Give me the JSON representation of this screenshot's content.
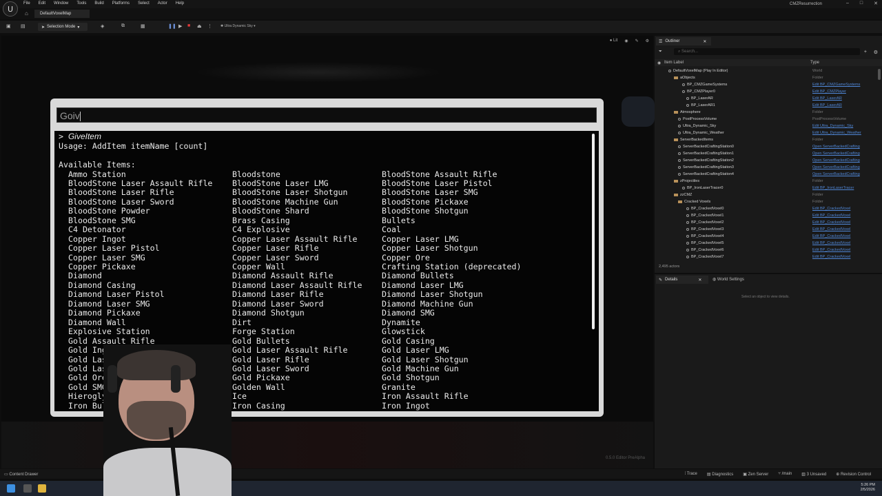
{
  "app": {
    "menu": [
      "File",
      "Edit",
      "Window",
      "Tools",
      "Build",
      "Platforms",
      "Select",
      "Actor",
      "Help"
    ],
    "project_name": "CMZResurrection",
    "window_controls": [
      "–",
      "□",
      "✕"
    ],
    "map_tab": "DefaultVoxelMap"
  },
  "toolbar": {
    "mode_label": "Selection Mode",
    "sky_label": "Ultra Dynamic Sky"
  },
  "viewport": {
    "view_mode": "Lit",
    "version_text": "0.5.0 Editor PreAlpha"
  },
  "console": {
    "input_value": "Goiv",
    "output": {
      "command_prefix": ">",
      "command": "GiveItem",
      "usage": "Usage: AddItem itemName [count]",
      "available_header": "Available Items:",
      "rows": [
        [
          "Ammo Station",
          "Bloodstone",
          "BloodStone Assault Rifle"
        ],
        [
          "BloodStone Laser Assault Rifle",
          "BloodStone Laser LMG",
          "BloodStone Laser Pistol"
        ],
        [
          "BloodStone Laser Rifle",
          "BloodStone Laser Shotgun",
          "BloodStone Laser SMG"
        ],
        [
          "BloodStone Laser Sword",
          "BloodStone Machine Gun",
          "BloodStone Pickaxe"
        ],
        [
          "BloodStone Powder",
          "BloodStone Shard",
          "BloodStone Shotgun"
        ],
        [
          "BloodStone SMG",
          "Brass Casing",
          "Bullets"
        ],
        [
          "C4 Detonator",
          "C4 Explosive",
          "Coal"
        ],
        [
          "Copper Ingot",
          "Copper Laser Assault Rifle",
          "Copper Laser LMG"
        ],
        [
          "Copper Laser Pistol",
          "Copper Laser Rifle",
          "Copper Laser Shotgun"
        ],
        [
          "Copper Laser SMG",
          "Copper Laser Sword",
          "Copper Ore"
        ],
        [
          "Copper Pickaxe",
          "Copper Wall",
          "Crafting Station (deprecated)"
        ],
        [
          "Diamond",
          "Diamond Assault Rifle",
          "Diamond Bullets"
        ],
        [
          "Diamond Casing",
          "Diamond Laser Assault Rifle",
          "Diamond Laser LMG"
        ],
        [
          "Diamond Laser Pistol",
          "Diamond Laser Rifle",
          "Diamond Laser Shotgun"
        ],
        [
          "Diamond Laser SMG",
          "Diamond Laser Sword",
          "Diamond Machine Gun"
        ],
        [
          "Diamond Pickaxe",
          "Diamond Shotgun",
          "Diamond SMG"
        ],
        [
          "Diamond Wall",
          "Dirt",
          "Dynamite"
        ],
        [
          "Explosive Station",
          "Forge Station",
          "Glowstick"
        ],
        [
          "Gold Assault Rifle",
          "Gold Bullets",
          "Gold Casing"
        ],
        [
          "Gold Ingot",
          "Gold Laser Assault Rifle",
          "Gold Laser LMG"
        ],
        [
          "Gold Laser",
          "Gold Laser Rifle",
          "Gold Laser Shotgun"
        ],
        [
          "Gold Laser",
          "Gold Laser Sword",
          "Gold Machine Gun"
        ],
        [
          "Gold Ore",
          "Gold Pickaxe",
          "Gold Shotgun"
        ],
        [
          "Gold SMG",
          "Golden Wall",
          "Granite"
        ],
        [
          "Hieroglyp",
          "Ice",
          "Iron Assault Rifle"
        ],
        [
          "Iron Bulle",
          "Iron Casing",
          "Iron Ingot"
        ]
      ]
    }
  },
  "outliner": {
    "tab_label": "Outliner",
    "search_placeholder": "Search...",
    "col_label": "Item Label",
    "col_type": "Type",
    "actor_count": "2,495 actors",
    "rows": [
      {
        "label": "DefaultVoxelMap (Play In Editor)",
        "type": "World",
        "kind": "world",
        "link": false
      },
      {
        "label": "aObjects",
        "type": "Folder",
        "kind": "folder",
        "link": false
      },
      {
        "label": "BP_CMZGameSystems",
        "type": "Edit BP_CMZGameSystems",
        "kind": "actor",
        "link": true
      },
      {
        "label": "BP_CMZPlayer0",
        "type": "Edit BP_CMZPlayer",
        "kind": "actor",
        "link": true
      },
      {
        "label": "BP_LaserAR",
        "type": "Edit BP_LaserAR",
        "kind": "actor",
        "link": true
      },
      {
        "label": "BP_LaserAR1",
        "type": "Edit BP_LaserAR",
        "kind": "actor",
        "link": true
      },
      {
        "label": "Atmosphere",
        "type": "Folder",
        "kind": "folder",
        "link": false
      },
      {
        "label": "PostProcessVolume",
        "type": "PostProcessVolume",
        "kind": "actor",
        "link": false
      },
      {
        "label": "Ultra_Dynamic_Sky",
        "type": "Edit Ultra_Dynamic_Sky",
        "kind": "actor",
        "link": true
      },
      {
        "label": "Ultra_Dynamic_Weather",
        "type": "Edit Ultra_Dynamic_Weather",
        "kind": "actor",
        "link": true
      },
      {
        "label": "ServerBackedItems",
        "type": "Folder",
        "kind": "folder",
        "link": false
      },
      {
        "label": "ServerBackedCraftingStation0",
        "type": "Open ServerBackedCrafting",
        "kind": "actor",
        "link": true
      },
      {
        "label": "ServerBackedCraftingStation1",
        "type": "Open ServerBackedCrafting",
        "kind": "actor",
        "link": true
      },
      {
        "label": "ServerBackedCraftingStation2",
        "type": "Open ServerBackedCrafting",
        "kind": "actor",
        "link": true
      },
      {
        "label": "ServerBackedCraftingStation3",
        "type": "Open ServerBackedCrafting",
        "kind": "actor",
        "link": true
      },
      {
        "label": "ServerBackedCraftingStation4",
        "type": "Open ServerBackedCrafting",
        "kind": "actor",
        "link": true
      },
      {
        "label": "zProjectiles",
        "type": "Folder",
        "kind": "folder",
        "link": false
      },
      {
        "label": "BP_IronLaserTracer0",
        "type": "Edit BP_IronLaserTracer",
        "kind": "actor",
        "link": true
      },
      {
        "label": "zzCMZ",
        "type": "Folder",
        "kind": "folder",
        "link": false
      },
      {
        "label": "Cracked Voxels",
        "type": "Folder",
        "kind": "folder",
        "link": false
      },
      {
        "label": "BP_CrackedVoxel0",
        "type": "Edit BP_CrackedVoxel",
        "kind": "actor",
        "link": true
      },
      {
        "label": "BP_CrackedVoxel1",
        "type": "Edit BP_CrackedVoxel",
        "kind": "actor",
        "link": true
      },
      {
        "label": "BP_CrackedVoxel2",
        "type": "Edit BP_CrackedVoxel",
        "kind": "actor",
        "link": true
      },
      {
        "label": "BP_CrackedVoxel3",
        "type": "Edit BP_CrackedVoxel",
        "kind": "actor",
        "link": true
      },
      {
        "label": "BP_CrackedVoxel4",
        "type": "Edit BP_CrackedVoxel",
        "kind": "actor",
        "link": true
      },
      {
        "label": "BP_CrackedVoxel5",
        "type": "Edit BP_CrackedVoxel",
        "kind": "actor",
        "link": true
      },
      {
        "label": "BP_CrackedVoxel6",
        "type": "Edit BP_CrackedVoxel",
        "kind": "actor",
        "link": true
      },
      {
        "label": "BP_CrackedVoxel7",
        "type": "Edit BP_CrackedVoxel",
        "kind": "actor",
        "link": true
      }
    ]
  },
  "details": {
    "tab_label": "Details",
    "world_settings_label": "World Settings",
    "empty_message": "Select an object to view details."
  },
  "statusbar": {
    "content_drawer": "Content Drawer",
    "trace": "Trace",
    "diagnostics": "Diagnostics",
    "zen_server": "Zen Server",
    "branch": "/main",
    "unsaved": "3 Unsaved",
    "revision_control": "Revision Control"
  },
  "taskbar": {
    "time": "5:26 PM",
    "date": "2/5/2026"
  }
}
